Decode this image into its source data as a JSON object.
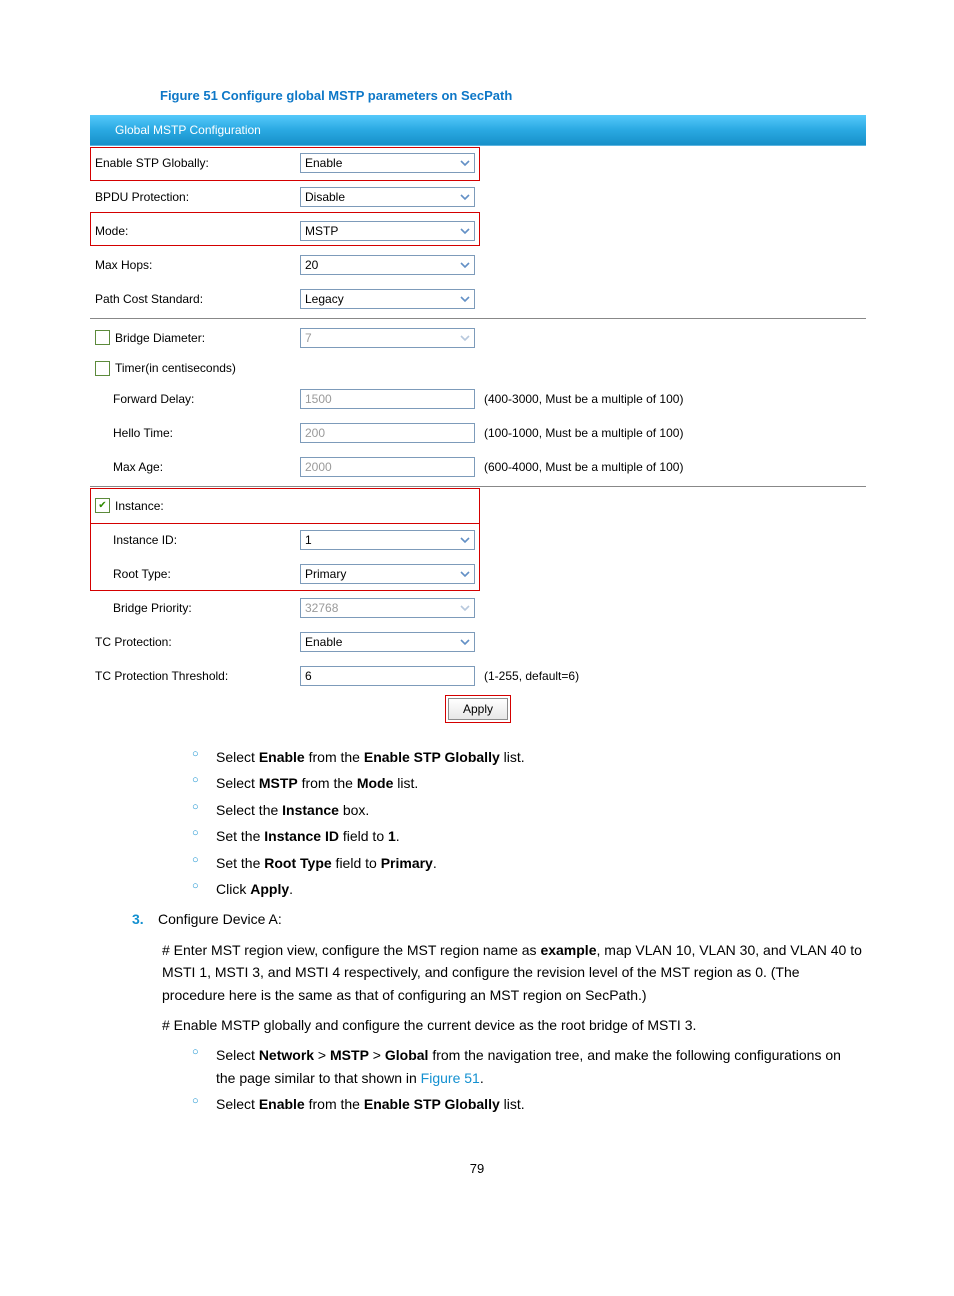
{
  "caption": "Figure 51 Configure global MSTP parameters on SecPath",
  "panel": {
    "title": "Global MSTP Configuration",
    "rows": {
      "enable_stp": {
        "label": "Enable STP Globally:",
        "value": "Enable"
      },
      "bpdu": {
        "label": "BPDU Protection:",
        "value": "Disable"
      },
      "mode": {
        "label": "Mode:",
        "value": "MSTP"
      },
      "maxhops": {
        "label": "Max Hops:",
        "value": "20"
      },
      "pathcost": {
        "label": "Path Cost Standard:",
        "value": "Legacy"
      },
      "bridgediam": {
        "label": "Bridge Diameter:",
        "value": "7"
      },
      "timer": {
        "label": "Timer(in centiseconds)"
      },
      "fwddelay": {
        "label": "Forward Delay:",
        "value": "1500",
        "hint": "(400-3000, Must be a multiple of 100)"
      },
      "hello": {
        "label": "Hello Time:",
        "value": "200",
        "hint": "(100-1000, Must be a multiple of 100)"
      },
      "maxage": {
        "label": "Max Age:",
        "value": "2000",
        "hint": "(600-4000, Must be a multiple of 100)"
      },
      "instance": {
        "label": "Instance:"
      },
      "instanceid": {
        "label": "Instance ID:",
        "value": "1"
      },
      "roottype": {
        "label": "Root Type:",
        "value": "Primary"
      },
      "bridgepri": {
        "label": "Bridge Priority:",
        "value": "32768"
      },
      "tcprot": {
        "label": "TC Protection:",
        "value": "Enable"
      },
      "tcprotthr": {
        "label": "TC Protection Threshold:",
        "value": "6",
        "hint": "(1-255, default=6)"
      }
    },
    "apply": "Apply"
  },
  "steps": {
    "sublist1": [
      {
        "pre": "Select ",
        "b1": "Enable",
        "mid": " from the ",
        "b2": "Enable STP Globally",
        "post": " list."
      },
      {
        "pre": "Select ",
        "b1": "MSTP",
        "mid": " from the ",
        "b2": "Mode",
        "post": " list."
      },
      {
        "pre": "Select the ",
        "b1": "Instance",
        "mid": "",
        "b2": "",
        "post": " box."
      },
      {
        "pre": "Set the ",
        "b1": "Instance ID",
        "mid": " field to ",
        "b2": "1",
        "post": "."
      },
      {
        "pre": "Set the ",
        "b1": "Root Type",
        "mid": " field to ",
        "b2": "Primary",
        "post": "."
      },
      {
        "pre": "Click ",
        "b1": "Apply",
        "mid": "",
        "b2": "",
        "post": "."
      }
    ],
    "step3": {
      "num": "3.",
      "text": "Configure Device A:"
    },
    "para1_pre": "# Enter MST region view, configure the MST region name as ",
    "para1_bold": "example",
    "para1_post": ", map VLAN 10, VLAN 30, and VLAN 40 to MSTI 1, MSTI 3, and MSTI 4 respectively, and configure the revision level of the MST region as 0. (The procedure here is the same as that of configuring an MST region on SecPath.)",
    "para2": "# Enable MSTP globally and configure the current device as the root bridge of MSTI 3.",
    "sublist2_item1_pre": "Select ",
    "sublist2_item1_b1": "Network",
    "sublist2_item1_gt1": " > ",
    "sublist2_item1_b2": "MSTP",
    "sublist2_item1_gt2": " > ",
    "sublist2_item1_b3": "Global",
    "sublist2_item1_mid": " from the navigation tree, and make the following configurations on the page similar to that shown in ",
    "sublist2_item1_link": "Figure 51",
    "sublist2_item1_post": ".",
    "sublist2_item2_pre": "Select ",
    "sublist2_item2_b1": "Enable",
    "sublist2_item2_mid": " from the ",
    "sublist2_item2_b2": "Enable STP Globally",
    "sublist2_item2_post": " list."
  },
  "pagenum": "79"
}
